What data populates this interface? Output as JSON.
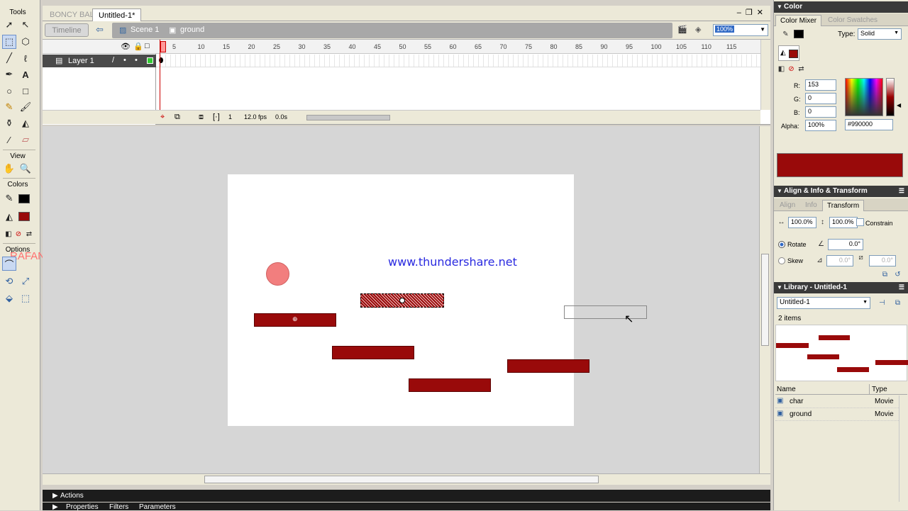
{
  "tools": {
    "header": "Tools",
    "view_header": "View",
    "colors_header": "Colors",
    "options_header": "Options",
    "watermark": "RAFAN z"
  },
  "document": {
    "tabs": [
      {
        "label": "BONCY BALL",
        "active": false
      },
      {
        "label": "Untitled-1*",
        "active": true
      }
    ],
    "timeline_button": "Timeline",
    "scene": "Scene 1",
    "symbol": "ground",
    "zoom": "100%"
  },
  "timeline": {
    "layer_name": "Layer 1",
    "frame_numbers": [
      "5",
      "10",
      "15",
      "20",
      "25",
      "30",
      "35",
      "40",
      "45",
      "50",
      "55",
      "60",
      "65",
      "70",
      "75",
      "80",
      "85",
      "90",
      "95",
      "100",
      "105",
      "110",
      "115"
    ],
    "current_frame": "1",
    "fps": "12.0 fps",
    "time": "0.0s"
  },
  "stage": {
    "watermark_text": "www.thundershare.net"
  },
  "bottom": {
    "actions": "Actions",
    "properties": "Properties",
    "filters": "Filters",
    "parameters": "Parameters"
  },
  "color_panel": {
    "title": "Color",
    "tabs": [
      "Color Mixer",
      "Color Swatches"
    ],
    "type_label": "Type:",
    "type_value": "Solid",
    "r_label": "R:",
    "r_value": "153",
    "g_label": "G:",
    "g_value": "0",
    "b_label": "B:",
    "b_value": "0",
    "alpha_label": "Alpha:",
    "alpha_value": "100%",
    "hex": "#990000",
    "fill_color": "#990a0a"
  },
  "transform_panel": {
    "title": "Align & Info & Transform",
    "tabs": [
      "Align",
      "Info",
      "Transform"
    ],
    "width_pct": "100.0%",
    "height_pct": "100.0%",
    "constrain": "Constrain",
    "rotate_label": "Rotate",
    "rotate_value": "0.0°",
    "skew_label": "Skew",
    "skew_h": "0.0°",
    "skew_v": "0.0°"
  },
  "library_panel": {
    "title": "Library - Untitled-1",
    "doc_select": "Untitled-1",
    "count": "2 items",
    "col_name": "Name",
    "col_type": "Type",
    "items": [
      {
        "name": "char",
        "type": "Movie"
      },
      {
        "name": "ground",
        "type": "Movie"
      }
    ]
  }
}
